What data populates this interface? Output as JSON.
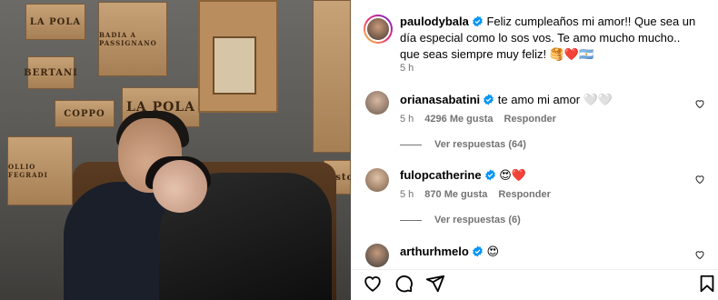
{
  "post": {
    "username": "paulodybala",
    "caption": "Feliz cumpleaños mi amor!! Que sea un día especial como lo sos vos. Te amo mucho mucho.. que seas siempre muy feliz! 🥞❤️🇦🇷",
    "time": "5 h"
  },
  "comments": [
    {
      "username": "orianasabatini",
      "text": "te amo mi amor 🤍🤍",
      "time": "5 h",
      "likes": "4296 Me gusta",
      "reply": "Responder",
      "view_replies": "Ver respuestas (64)"
    },
    {
      "username": "fulopcatherine",
      "text": "😍❤️",
      "time": "5 h",
      "likes": "870 Me gusta",
      "reply": "Responder",
      "view_replies": "Ver respuestas (6)"
    },
    {
      "username": "arthurhmelo",
      "text": "😍"
    }
  ],
  "photo": {
    "signs": [
      "LA POLA",
      "BADIA A PASSIGNANO",
      "BERTANI",
      "COPPO",
      "LA POLA",
      "OLLIO FEGRADI",
      "Casto"
    ]
  },
  "colors": {
    "verified": "#0095f6",
    "meta": "#737373",
    "heart": "#ed4956"
  },
  "icons": [
    "heart-icon",
    "comment-icon",
    "share-icon",
    "bookmark-icon",
    "verified-icon"
  ]
}
